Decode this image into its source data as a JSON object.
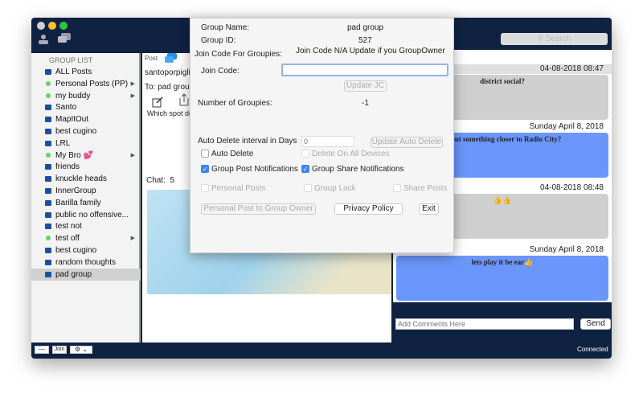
{
  "window": {
    "controls": [
      "close",
      "minimize",
      "maximize"
    ],
    "header_icons": [
      "person-icon",
      "chat-bubbles-icon"
    ],
    "search_placeholder": "Search"
  },
  "sidebar": {
    "title": "GROUP LIST",
    "items": [
      {
        "label": "ALL Posts",
        "icon": "chat",
        "arrow": false
      },
      {
        "label": "Personal Posts (PP)",
        "icon": "dot",
        "arrow": true
      },
      {
        "label": "my buddy",
        "icon": "dot",
        "arrow": true
      },
      {
        "label": "Santo",
        "icon": "chat",
        "arrow": false
      },
      {
        "label": "MapItOut",
        "icon": "chat",
        "arrow": false
      },
      {
        "label": "best cugino",
        "icon": "chat",
        "arrow": false
      },
      {
        "label": "LRL",
        "icon": "chat",
        "arrow": false
      },
      {
        "label": "My Bro 💕",
        "icon": "dot",
        "arrow": true
      },
      {
        "label": "friends",
        "icon": "chat",
        "arrow": false
      },
      {
        "label": "knuckle heads",
        "icon": "chat",
        "arrow": false
      },
      {
        "label": "InnerGroup",
        "icon": "chat",
        "arrow": false
      },
      {
        "label": "Barilla family",
        "icon": "chat",
        "arrow": false
      },
      {
        "label": "public no offensive...",
        "icon": "chat",
        "arrow": false
      },
      {
        "label": "test not",
        "icon": "chat",
        "arrow": false
      },
      {
        "label": "test off",
        "icon": "dot",
        "arrow": true
      },
      {
        "label": "best cugino",
        "icon": "chat",
        "arrow": false
      },
      {
        "label": "random thoughts",
        "icon": "chat",
        "arrow": false
      },
      {
        "label": "pad group",
        "icon": "chat",
        "arrow": false,
        "selected": true
      }
    ]
  },
  "middle": {
    "post_label": "Post",
    "author": "santoporpiglia",
    "to": "To: pad group",
    "post_text": "Which spot do",
    "chat_label": "Chat:",
    "chat_count": "5"
  },
  "messages": [
    {
      "date": "04-08-2018 08:47",
      "text": "district social?",
      "color": "gray"
    },
    {
      "date": "Sunday April 8, 2018",
      "text": "about something closer to Radio City?",
      "color": "blue"
    },
    {
      "date": "04-08-2018 08:48",
      "text": "👍👍",
      "color": "gray"
    },
    {
      "date": "Sunday April 8, 2018",
      "text": "lets play it be ear👍",
      "color": "blue"
    }
  ],
  "comment": {
    "placeholder": "Add Comments Here",
    "send": "Send"
  },
  "footer": {
    "minus": "—",
    "join": "Join",
    "status": "Connected"
  },
  "dialog": {
    "group_name_label": "Group Name:",
    "group_name": "pad group",
    "group_id_label": "Group ID:",
    "group_id": "527",
    "join_code_groupies_label": "Join Code For Groupies:",
    "join_code_info": "Join Code N/A Update if you GroupOwner",
    "join_code_label": "Join Code:",
    "join_code_value": "",
    "update_jc": "Update JC",
    "groupies_label": "Number of Groupies:",
    "groupies": "-1",
    "auto_delete_label": "Auto Delete interval in Days",
    "auto_delete_placeholder": "0",
    "update_auto_delete": "Update Auto Delete",
    "auto_delete": {
      "label": "Auto Delete",
      "checked": false
    },
    "delete_all": {
      "label": "Delete On All Devices",
      "checked": false
    },
    "post_notif": {
      "label": "Group Post Notifications",
      "checked": true
    },
    "share_notif": {
      "label": "Group Share Notifications",
      "checked": true
    },
    "personal_posts": {
      "label": "Personal Posts",
      "checked": false
    },
    "group_lock": {
      "label": "Group Lock",
      "checked": false
    },
    "share_posts": {
      "label": "Share Posts",
      "checked": false
    },
    "personal_post_owner": "Personal Post to Group Owner",
    "privacy": "Privacy Policy",
    "exit": "Exit"
  },
  "colors": {
    "navy": "#0f2241",
    "bubble_blue": "#6b96fb",
    "bubble_gray": "#cfcfcf"
  }
}
